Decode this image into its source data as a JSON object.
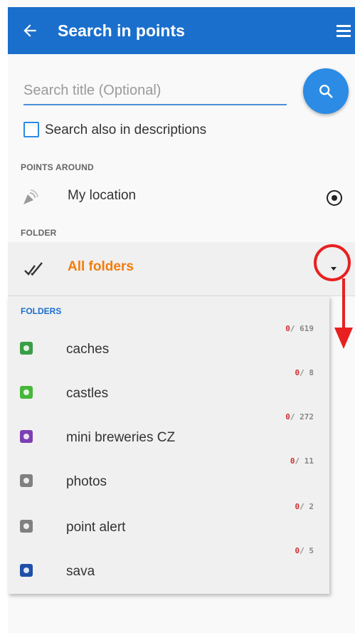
{
  "header": {
    "title": "Search in points"
  },
  "search": {
    "placeholder": "Search title (Optional)",
    "value": ""
  },
  "options": {
    "search_descriptions_label": "Search also in descriptions",
    "search_descriptions_checked": false
  },
  "points_around": {
    "section_label": "POINTS AROUND",
    "location_label": "My location",
    "selected": true
  },
  "folder": {
    "section_label": "FOLDER",
    "selected_value": "All folders"
  },
  "folders_panel": {
    "header": "FOLDERS",
    "items": [
      {
        "name": "caches",
        "selected": "0",
        "total": "/ 619",
        "icon": "caches-icon",
        "color": "#3a9e46"
      },
      {
        "name": "castles",
        "selected": "0",
        "total": "/ 8",
        "icon": "castles-icon",
        "color": "#46b73a"
      },
      {
        "name": "mini breweries CZ",
        "selected": "0",
        "total": "/ 272",
        "icon": "breweries-icon",
        "color": "#7b3fb3"
      },
      {
        "name": "photos",
        "selected": "0",
        "total": "/ 11",
        "icon": "photos-icon",
        "color": "#808080"
      },
      {
        "name": "point alert",
        "selected": "0",
        "total": "/ 2",
        "icon": "alert-icon",
        "color": "#808080"
      },
      {
        "name": "sava",
        "selected": "0",
        "total": "/ 5",
        "icon": "sava-icon",
        "color": "#1f4fa8"
      }
    ]
  },
  "colors": {
    "appbar": "#1a6fcc",
    "accent": "#2b8be5",
    "folder_selected": "#f27d0c",
    "callout": "#e82020"
  }
}
